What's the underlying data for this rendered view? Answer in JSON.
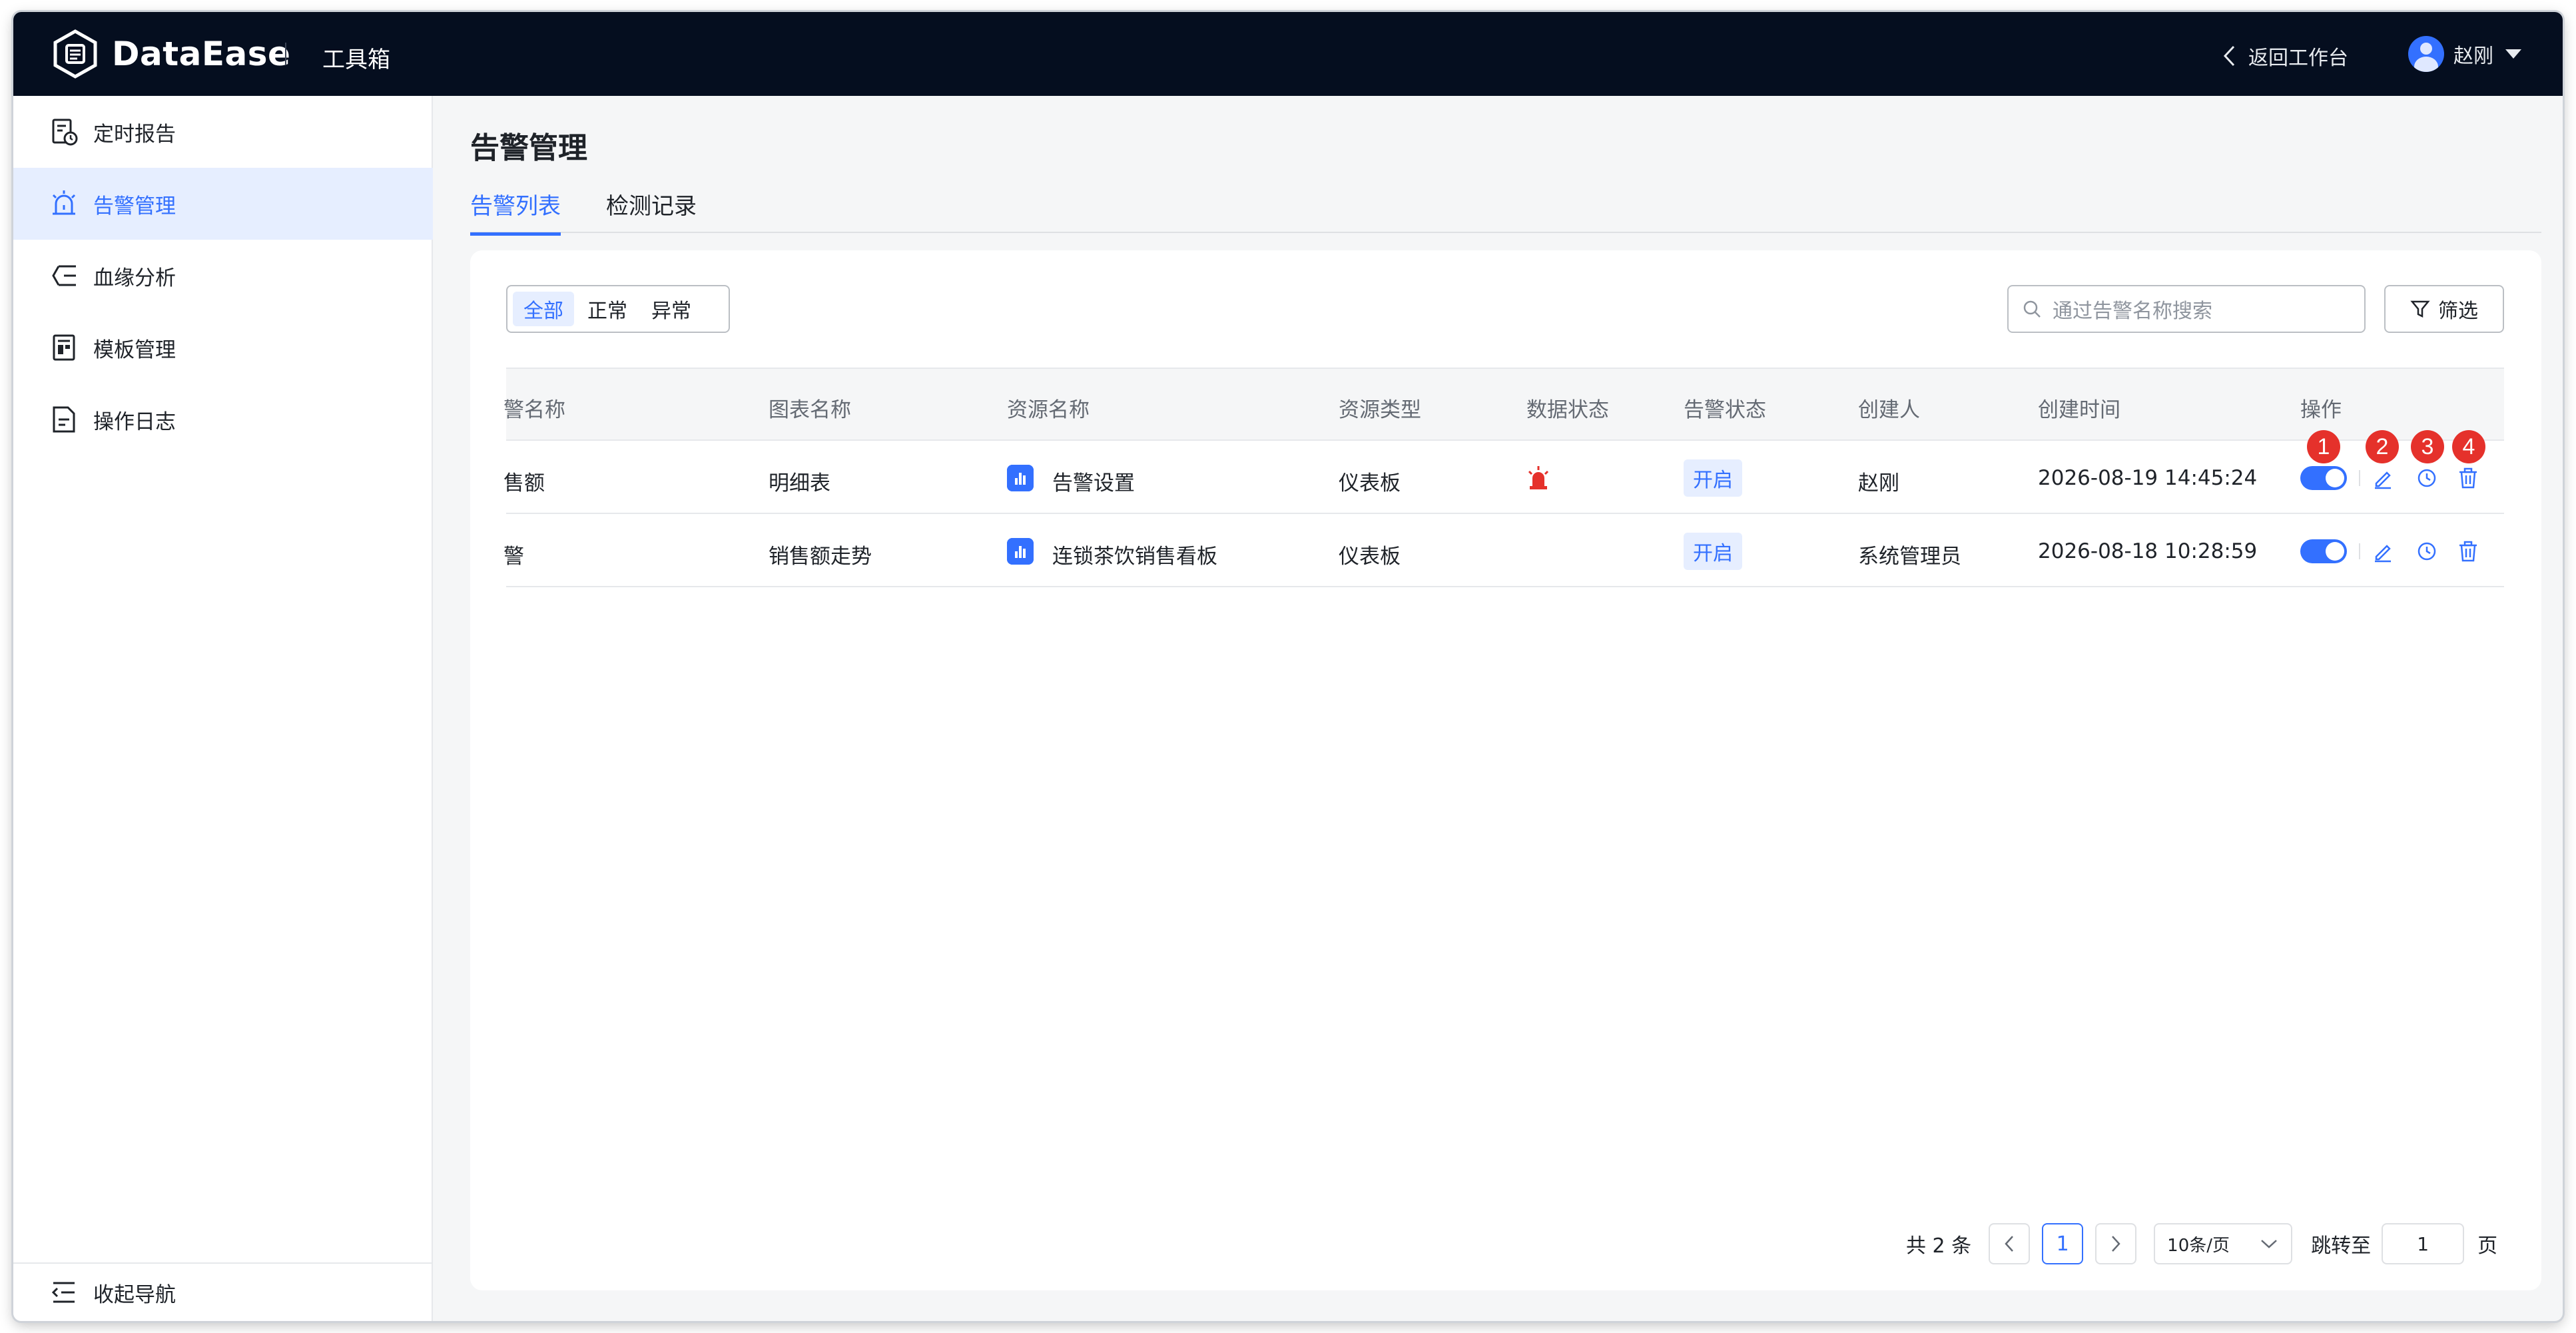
{
  "header": {
    "brand": "DataEase",
    "app_name": "工具箱",
    "back_label": "返回工作台",
    "user_name": "赵刚"
  },
  "sidebar": {
    "items": [
      {
        "label": "定时报告",
        "icon": "scheduled-report-icon",
        "active": false
      },
      {
        "label": "告警管理",
        "icon": "alarm-icon",
        "active": true
      },
      {
        "label": "血缘分析",
        "icon": "lineage-icon",
        "active": false
      },
      {
        "label": "模板管理",
        "icon": "template-icon",
        "active": false
      },
      {
        "label": "操作日志",
        "icon": "log-icon",
        "active": false
      }
    ],
    "collapse_label": "收起导航"
  },
  "page": {
    "title": "告警管理",
    "tabs": [
      "告警列表",
      "检测记录"
    ],
    "active_tab": 0
  },
  "filters": {
    "segments": [
      "全部",
      "正常",
      "异常"
    ],
    "active_segment": 0,
    "search_placeholder": "通过告警名称搜索",
    "filter_label": "筛选"
  },
  "table": {
    "columns": [
      "警名称",
      "图表名称",
      "资源名称",
      "资源类型",
      "数据状态",
      "告警状态",
      "创建人",
      "创建时间",
      "操作"
    ],
    "rows": [
      {
        "name": "售额",
        "chart": "明细表",
        "resource": "告警设置",
        "resource_type": "仪表板",
        "data_alarm": true,
        "status": "开启",
        "creator": "赵刚",
        "created": "2026-08-19 14:45:24",
        "enabled": true
      },
      {
        "name": "警",
        "chart": "销售额走势",
        "resource": "连锁茶饮销售看板",
        "resource_type": "仪表板",
        "data_alarm": false,
        "status": "开启",
        "creator": "系统管理员",
        "created": "2026-08-18 10:28:59",
        "enabled": true
      }
    ],
    "action_badges": [
      "1",
      "2",
      "3",
      "4"
    ]
  },
  "pagination": {
    "total_label": "共 2 条",
    "current_page": "1",
    "page_size": "10条/页",
    "jump_label": "跳转至",
    "jump_value": "1",
    "page_suffix": "页"
  },
  "colors": {
    "accent": "#3370ff",
    "header_bg": "#050e1f",
    "badge": "#e5312b"
  }
}
